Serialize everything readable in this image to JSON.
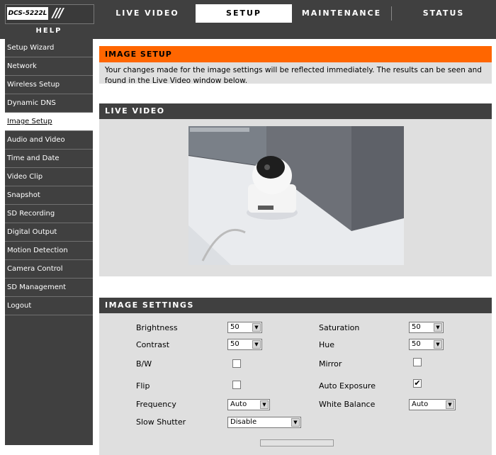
{
  "header": {
    "logo": "DCS-5222L",
    "help": "HELP",
    "tabs": [
      {
        "label": "LIVE VIDEO"
      },
      {
        "label": "SETUP"
      },
      {
        "label": "MAINTENANCE"
      },
      {
        "label": "STATUS"
      }
    ]
  },
  "sidebar": {
    "items": [
      {
        "label": "Setup Wizard"
      },
      {
        "label": "Network"
      },
      {
        "label": "Wireless Setup"
      },
      {
        "label": "Dynamic DNS"
      },
      {
        "label": "Image Setup"
      },
      {
        "label": "Audio and Video"
      },
      {
        "label": "Time and Date"
      },
      {
        "label": "Video Clip"
      },
      {
        "label": "Snapshot"
      },
      {
        "label": "SD Recording"
      },
      {
        "label": "Digital Output"
      },
      {
        "label": "Motion Detection"
      },
      {
        "label": "Camera Control"
      },
      {
        "label": "SD Management"
      },
      {
        "label": "Logout"
      }
    ]
  },
  "image_setup": {
    "title": "IMAGE SETUP",
    "description": "Your changes made for the image settings will be reflected immediately. The results can be seen and found in the Live Video window below."
  },
  "live_video": {
    "title": "LIVE VIDEO"
  },
  "image_settings": {
    "title": "IMAGE SETTINGS",
    "brightness": {
      "label": "Brightness",
      "value": "50"
    },
    "contrast": {
      "label": "Contrast",
      "value": "50"
    },
    "bw": {
      "label": "B/W"
    },
    "flip": {
      "label": "Flip"
    },
    "frequency": {
      "label": "Frequency",
      "value": "Auto"
    },
    "slow_shutter": {
      "label": "Slow Shutter",
      "value": "Disable"
    },
    "saturation": {
      "label": "Saturation",
      "value": "50"
    },
    "hue": {
      "label": "Hue",
      "value": "50"
    },
    "mirror": {
      "label": "Mirror"
    },
    "auto_exposure": {
      "label": "Auto Exposure",
      "checked": "✔"
    },
    "white_balance": {
      "label": "White Balance",
      "value": "Auto"
    }
  }
}
